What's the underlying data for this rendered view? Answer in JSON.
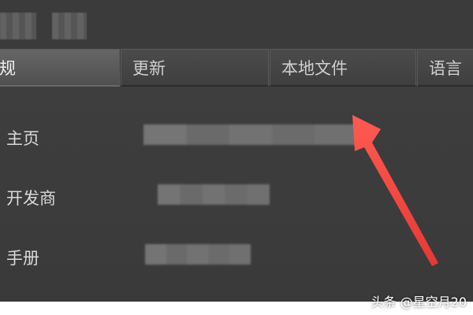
{
  "tabs": [
    {
      "label": "规",
      "active": true
    },
    {
      "label": "更新",
      "active": false
    },
    {
      "label": "本地文件",
      "active": false
    },
    {
      "label": "语言",
      "active": false
    }
  ],
  "rows": {
    "homepage_label": "主页",
    "developer_label": "开发商",
    "manual_label": "手册"
  },
  "annotation": {
    "arrow_color": "#e53935"
  },
  "watermark": "头条 @星空月20"
}
